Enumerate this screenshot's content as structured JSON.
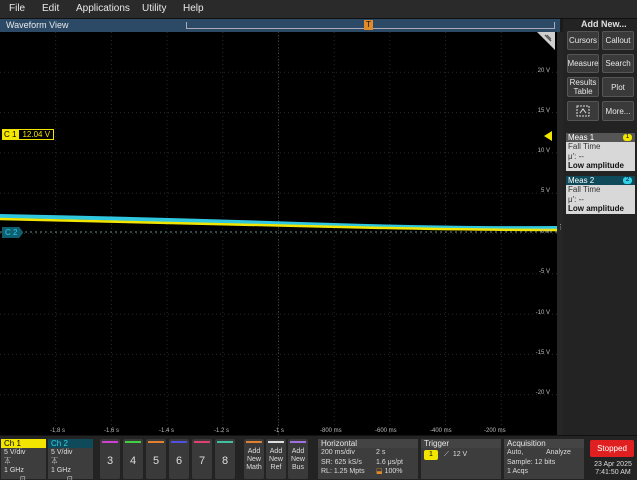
{
  "menu": [
    "File",
    "Edit",
    "Applications",
    "Utility",
    "Help"
  ],
  "add_new_title": "Add New...",
  "waveform_view": {
    "title": "Waveform View",
    "trigger_marker": "T"
  },
  "channels": {
    "c1": {
      "label": "C 1",
      "value": "12.04 V",
      "color": "#f2e600"
    },
    "c2": {
      "label": "C 2",
      "color": "#30d0e8"
    }
  },
  "y_axis_labels": [
    "20 V",
    "15 V",
    "10 V",
    "5 V",
    "0 V",
    "-5 V",
    "-10 V",
    "-15 V",
    "-20 V"
  ],
  "x_axis_labels": [
    "-1.8 s",
    "-1.6 s",
    "-1.4 s",
    "-1.2 s",
    "-1 s",
    "-800 ms",
    "-600 ms",
    "-400 ms",
    "-200 ms"
  ],
  "side_buttons": {
    "cursors": "Cursors",
    "callout": "Callout",
    "measure": "Measure",
    "search": "Search",
    "results_table": "Results Table",
    "plot": "Plot",
    "more": "More..."
  },
  "measurements": [
    {
      "title": "Meas 1",
      "badge": "1",
      "badge_color": "#f2e600",
      "title_bg": "#555555",
      "type": "Fall Time",
      "mu": "μ': --",
      "status": "Low amplitude"
    },
    {
      "title": "Meas 2",
      "badge": "2",
      "badge_color": "#30d0e8",
      "title_bg": "#0e4a5a",
      "type": "Fall Time",
      "mu": "μ': --",
      "status": "Low amplitude"
    }
  ],
  "bottom": {
    "ch1": {
      "name": "Ch 1",
      "vdiv": "5 V/div",
      "bw": "1 GHz"
    },
    "ch2": {
      "name": "Ch 2",
      "vdiv": "5 V/div",
      "bw": "1 GHz"
    },
    "num_buttons": [
      "3",
      "4",
      "5",
      "6",
      "7",
      "8"
    ],
    "add_buttons": [
      {
        "l1": "Add",
        "l2": "New",
        "l3": "Math"
      },
      {
        "l1": "Add",
        "l2": "New",
        "l3": "Ref"
      },
      {
        "l1": "Add",
        "l2": "New",
        "l3": "Bus"
      }
    ],
    "horizontal": {
      "title": "Horizontal",
      "scale": "200 ms/div",
      "duration": "2 s",
      "sample_rate": "SR: 625 kS/s",
      "resolution": "1.6 μs/pt",
      "record_length": "RL: 1.25 Mpts",
      "position": "100%"
    },
    "trigger": {
      "title": "Trigger",
      "source": "1",
      "level": "12 V"
    },
    "acquisition": {
      "title": "Acquisition",
      "mode": "Auto,",
      "analyze": "Analyze",
      "sample": "Sample: 12 bits",
      "acqs": "1 Acqs"
    },
    "run_state": "Stopped",
    "date": "23 Apr 2025",
    "time": "7:41:50 AM"
  }
}
